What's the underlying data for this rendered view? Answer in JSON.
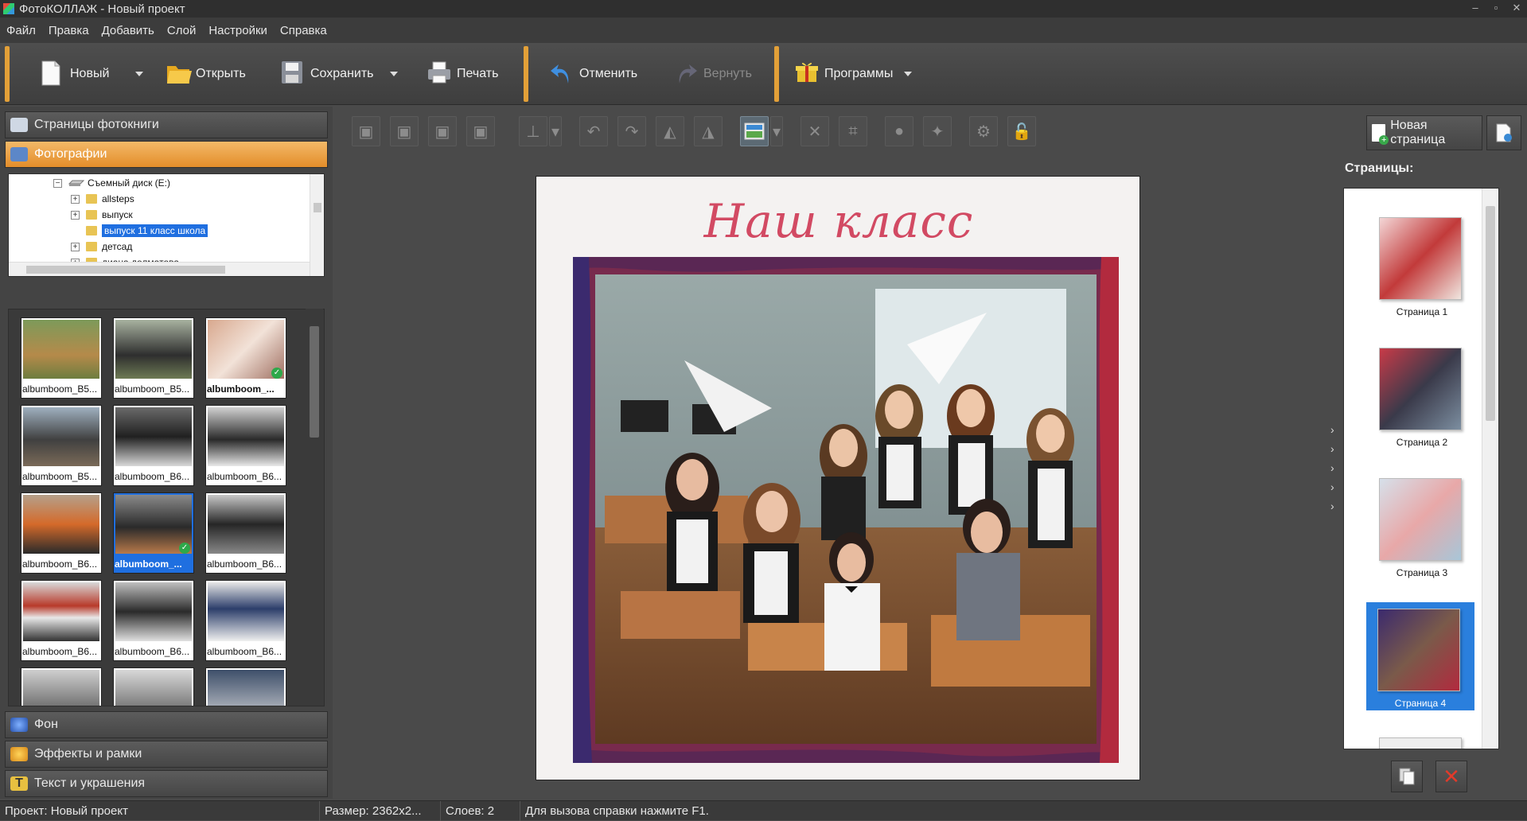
{
  "window": {
    "title": "ФотоКОЛЛАЖ - Новый проект",
    "controls": [
      "–",
      "▫",
      "✕"
    ]
  },
  "menu": [
    "Файл",
    "Правка",
    "Добавить",
    "Слой",
    "Настройки",
    "Справка"
  ],
  "toolbar": {
    "new_label": "Новый",
    "open_label": "Открыть",
    "save_label": "Сохранить",
    "print_label": "Печать",
    "undo_label": "Отменить",
    "redo_label": "Вернуть",
    "programs_label": "Программы"
  },
  "left_panel": {
    "sections": {
      "book_pages": "Страницы фотокниги",
      "photos": "Фотографии",
      "background": "Фон",
      "effects": "Эффекты и рамки",
      "text": "Текст и украшения"
    },
    "tree": {
      "drive": "Съемный диск (E:)",
      "folders": [
        "allsteps",
        "выпуск",
        "выпуск 11 класс школа",
        "детсад",
        "диана долматова"
      ],
      "selected_folder": "выпуск 11 класс школа"
    },
    "thumbnails": [
      "albumboom_B5...",
      "albumboom_B5...",
      "albumboom_...",
      "albumboom_B5...",
      "albumboom_B6...",
      "albumboom_B6...",
      "albumboom_B6...",
      "albumboom_...",
      "albumboom_B6...",
      "albumboom_B6...",
      "albumboom_B6...",
      "albumboom_B6..."
    ]
  },
  "canvas": {
    "page_title": "Наш класс"
  },
  "right_panel": {
    "new_page_label": "Новая страница",
    "pages_label": "Страницы:",
    "pages": [
      "Страница 1",
      "Страница 2",
      "Страница 3",
      "Страница 4"
    ],
    "selected_page": "Страница 4"
  },
  "status": {
    "project": "Проект:  Новый проект",
    "size": "Размер:  2362x2...",
    "layers": "Слоев:  2",
    "hint": "Для вызова справки нажмите F1."
  },
  "colors": {
    "accent": "#e3a038",
    "selection": "#1f6fe0",
    "title_text": "#d24a63",
    "frame": "#3a1e50"
  }
}
